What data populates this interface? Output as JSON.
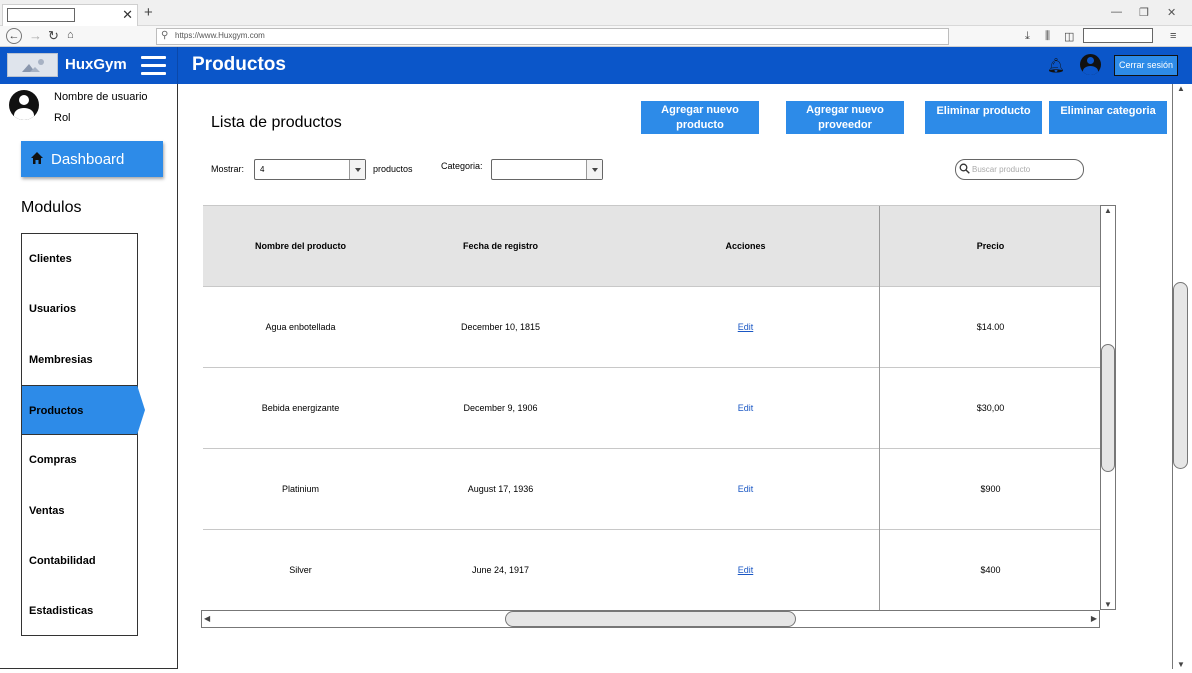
{
  "browser": {
    "url": "https://www.Huxgym.com"
  },
  "header": {
    "brand": "HuxGym",
    "page_title": "Productos",
    "logout_label": "Cerrar sesión"
  },
  "sidebar": {
    "user_name": "Nombre de usuario",
    "user_role": "Rol",
    "dashboard_label": "Dashboard",
    "modules_heading": "Modulos",
    "items": [
      {
        "label": "Clientes"
      },
      {
        "label": "Usuarios"
      },
      {
        "label": "Membresias"
      },
      {
        "label": "Productos",
        "active": true
      },
      {
        "label": "Compras"
      },
      {
        "label": "Ventas"
      },
      {
        "label": "Contabilidad"
      },
      {
        "label": "Estadisticas"
      }
    ]
  },
  "main": {
    "list_title": "Lista de productos",
    "buttons": {
      "add_product": "Agregar nuevo producto",
      "add_supplier": "Agregar nuevo proveedor",
      "delete_product": "Eliminar producto",
      "delete_category": "Eliminar categoria"
    },
    "filters": {
      "show_label": "Mostrar:",
      "show_value": "4",
      "products_suffix": "productos",
      "category_label": "Categoria:",
      "category_value": "",
      "search_placeholder": "Buscar producto"
    },
    "table": {
      "columns": [
        "Nombre del producto",
        "Fecha de registro",
        "Acciones",
        "Precio"
      ],
      "rows": [
        {
          "name": "Agua enbotellada",
          "date": "December 10, 1815",
          "action": "Edit",
          "price": "$14.00"
        },
        {
          "name": "Bebida energizante",
          "date": "December 9, 1906",
          "action": "Edit",
          "price": "$30,00"
        },
        {
          "name": "Platinium",
          "date": "August 17, 1936",
          "action": "Edit",
          "price": "$900"
        },
        {
          "name": "Silver",
          "date": "June 24, 1917",
          "action": "Edit",
          "price": "$400"
        }
      ]
    }
  },
  "colors": {
    "header_blue": "#0b56c9",
    "accent_blue": "#2d8be8",
    "table_header": "#e4e4e4"
  }
}
